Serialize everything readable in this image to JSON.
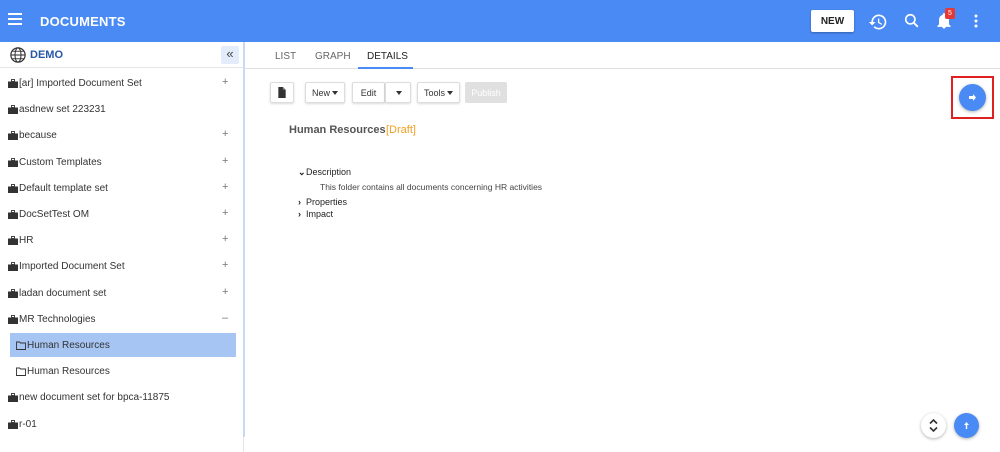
{
  "header": {
    "title": "DOCUMENTS",
    "new_label": "NEW",
    "notifications_count": "5",
    "icons": [
      "menu-icon",
      "history-icon",
      "search-icon",
      "bell-icon",
      "more-vertical-icon"
    ]
  },
  "sidebar": {
    "org_name": "DEMO",
    "items": [
      {
        "label": "[ar] Imported Document Set",
        "toggle": "+",
        "icon": "briefcase-icon"
      },
      {
        "label": "asdnew set 223231",
        "toggle": "",
        "icon": "briefcase-icon"
      },
      {
        "label": "because",
        "toggle": "+",
        "icon": "briefcase-icon"
      },
      {
        "label": "Custom Templates",
        "toggle": "+",
        "icon": "briefcase-icon"
      },
      {
        "label": "Default template set",
        "toggle": "+",
        "icon": "briefcase-icon"
      },
      {
        "label": "DocSetTest OM",
        "toggle": "+",
        "icon": "briefcase-icon"
      },
      {
        "label": "HR",
        "toggle": "+",
        "icon": "briefcase-icon"
      },
      {
        "label": "Imported Document Set",
        "toggle": "+",
        "icon": "briefcase-icon"
      },
      {
        "label": "ladan document set",
        "toggle": "+",
        "icon": "briefcase-icon"
      },
      {
        "label": "MR Technologies",
        "toggle": "–",
        "icon": "briefcase-icon"
      },
      {
        "label": "Human Resources",
        "toggle": "",
        "icon": "folder-icon",
        "selected": true
      },
      {
        "label": "Human Resources",
        "toggle": "",
        "icon": "folder-icon"
      },
      {
        "label": "new document set for bpca-11875",
        "toggle": "",
        "icon": "briefcase-icon"
      },
      {
        "label": "r-01",
        "toggle": "",
        "icon": "briefcase-icon"
      }
    ]
  },
  "tabs": [
    {
      "label": "LIST"
    },
    {
      "label": "GRAPH"
    },
    {
      "label": "DETAILS",
      "active": true
    }
  ],
  "toolbar": {
    "new_label": "New",
    "edit_label": "Edit",
    "tools_label": "Tools",
    "publish_label": "Publish"
  },
  "document": {
    "title": "Human Resources",
    "status": "[Draft]",
    "description_label": "Description",
    "description_text": "This folder contains all documents concerning HR activities",
    "properties_label": "Properties",
    "impact_label": "Impact"
  },
  "colors": {
    "primary": "#4a8af4",
    "selected_row": "#a7c5f3",
    "draft": "#f0a020",
    "badge": "#e53935",
    "highlight": "#e02020"
  }
}
